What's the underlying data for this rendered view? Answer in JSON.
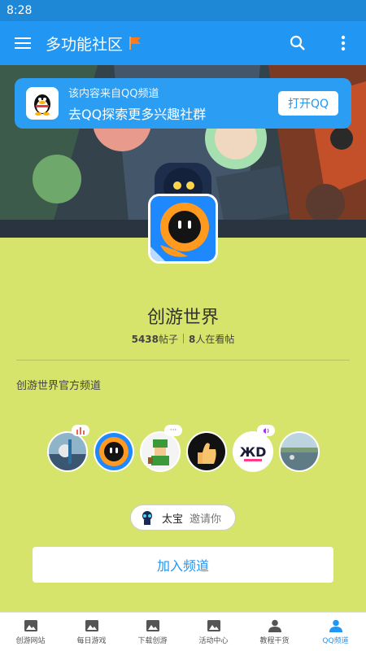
{
  "status_bar": {
    "time": "8:28"
  },
  "app_bar": {
    "title": "多功能社区",
    "menu_icon": "hamburger-icon",
    "search_icon": "search-icon",
    "more_icon": "more-vert-icon"
  },
  "qq_banner": {
    "line1": "该内容来自QQ频道",
    "line2": "去QQ探索更多兴趣社群",
    "open_button": "打开QQ"
  },
  "channel": {
    "name": "创游世界",
    "posts_count": "5438",
    "posts_label": "帖子",
    "online_count": "8",
    "online_label": "人在看帖",
    "description": "创游世界官方频道"
  },
  "invite": {
    "inviter": "太宝",
    "text": "邀请你"
  },
  "join_button": "加入频道",
  "bottom_nav": [
    {
      "label": "创游网站",
      "icon": "image-icon",
      "active": false
    },
    {
      "label": "每日游戏",
      "icon": "image-icon",
      "active": false
    },
    {
      "label": "下载创游",
      "icon": "image-icon",
      "active": false
    },
    {
      "label": "活动中心",
      "icon": "image-icon",
      "active": false
    },
    {
      "label": "教程干货",
      "icon": "person-icon",
      "active": false
    },
    {
      "label": "QQ频道",
      "icon": "person-icon",
      "active": true
    }
  ],
  "colors": {
    "primary": "#2196f3",
    "background": "#d6e46c",
    "status_bar": "#1e88d6"
  }
}
